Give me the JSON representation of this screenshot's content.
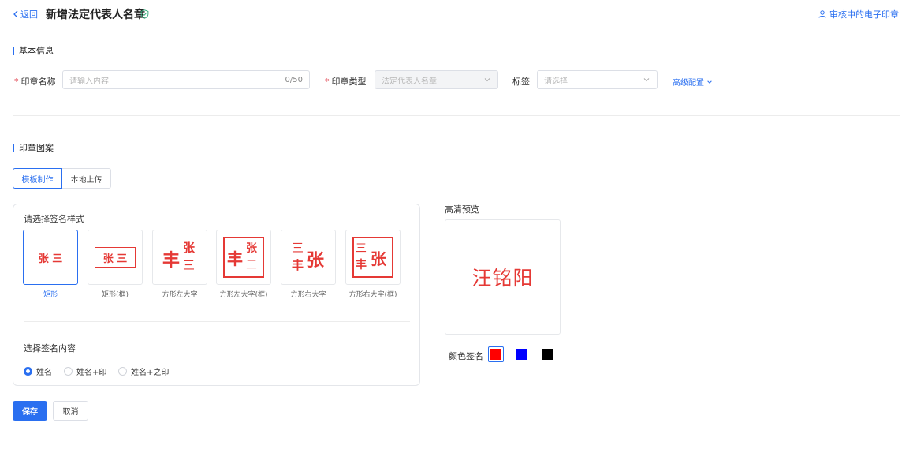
{
  "header": {
    "back_label": "返回",
    "title": "新增法定代表人名章",
    "review_link": "审核中的电子印章"
  },
  "basic_info": {
    "section_title": "基本信息",
    "seal_name": {
      "label": "印章名称",
      "placeholder": "请输入内容",
      "counter": "0/50"
    },
    "seal_type": {
      "label": "印章类型",
      "value": "法定代表人名章"
    },
    "tags": {
      "label": "标签",
      "placeholder": "请选择"
    },
    "advanced_label": "高级配置"
  },
  "seal_pattern": {
    "section_title": "印章图案",
    "tabs": [
      {
        "label": "模板制作",
        "active": true
      },
      {
        "label": "本地上传",
        "active": false
      }
    ],
    "style_prompt": "请选择签名样式",
    "styles": [
      {
        "caption": "矩形",
        "selected": true,
        "sample": "张 三"
      },
      {
        "caption": "矩形(框)",
        "selected": false,
        "sample": "张 三"
      },
      {
        "caption": "方形左大字",
        "selected": false,
        "big": "丰",
        "small_top": "张",
        "small_bottom": "三"
      },
      {
        "caption": "方形左大字(框)",
        "selected": false,
        "big": "丰",
        "small_top": "张",
        "small_bottom": "三"
      },
      {
        "caption": "方形右大字",
        "selected": false,
        "big": "张",
        "small_top": "三",
        "small_bottom": "丰"
      },
      {
        "caption": "方形右大字(框)",
        "selected": false,
        "big": "张",
        "small_top": "三",
        "small_bottom": "丰"
      }
    ],
    "content_prompt": "选择签名内容",
    "content_options": [
      {
        "label": "姓名",
        "selected": true
      },
      {
        "label": "姓名+印",
        "selected": false
      },
      {
        "label": "姓名+之印",
        "selected": false
      }
    ]
  },
  "preview": {
    "title": "高清预览",
    "text": "汪铭阳",
    "color_label": "颜色签名",
    "colors": [
      "#ff0000",
      "#0000ff",
      "#000000"
    ],
    "selected_color": "#ff0000"
  },
  "actions": {
    "save": "保存",
    "cancel": "取消"
  },
  "theme": {
    "accent": "#2a6ff0",
    "seal_red": "#e53935"
  }
}
